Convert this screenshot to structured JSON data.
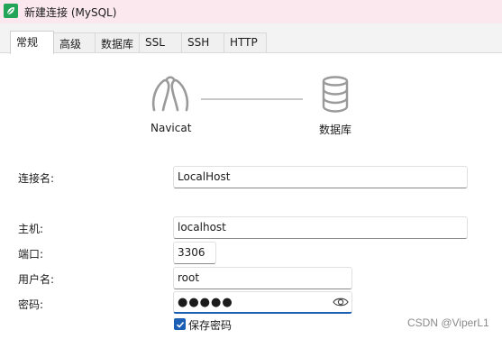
{
  "window": {
    "title": "新建连接 (MySQL)",
    "app_icon": "navicat-leaf-icon",
    "titlebar_color": "#fbe8ee"
  },
  "tabs": [
    {
      "label": "常规",
      "active": true
    },
    {
      "label": "高级",
      "active": false
    },
    {
      "label": "数据库",
      "active": false
    },
    {
      "label": "SSL",
      "active": false
    },
    {
      "label": "SSH",
      "active": false
    },
    {
      "label": "HTTP",
      "active": false
    }
  ],
  "diagram": {
    "left_icon": "navicat-icon",
    "left_label": "Navicat",
    "right_icon": "database-icon",
    "right_label": "数据库"
  },
  "form": {
    "connection_name": {
      "label": "连接名:",
      "value": "LocalHost"
    },
    "host": {
      "label": "主机:",
      "value": "localhost"
    },
    "port": {
      "label": "端口:",
      "value": "3306"
    },
    "username": {
      "label": "用户名:",
      "value": "root"
    },
    "password": {
      "label": "密码:",
      "value": "●●●●●",
      "icon": "eye-icon"
    },
    "save_password": {
      "label": "保存密码",
      "checked": true
    }
  },
  "watermark": "CSDN @ViperL1",
  "colors": {
    "accent": "#1a5fb4",
    "app_icon_green": "#22a559"
  }
}
